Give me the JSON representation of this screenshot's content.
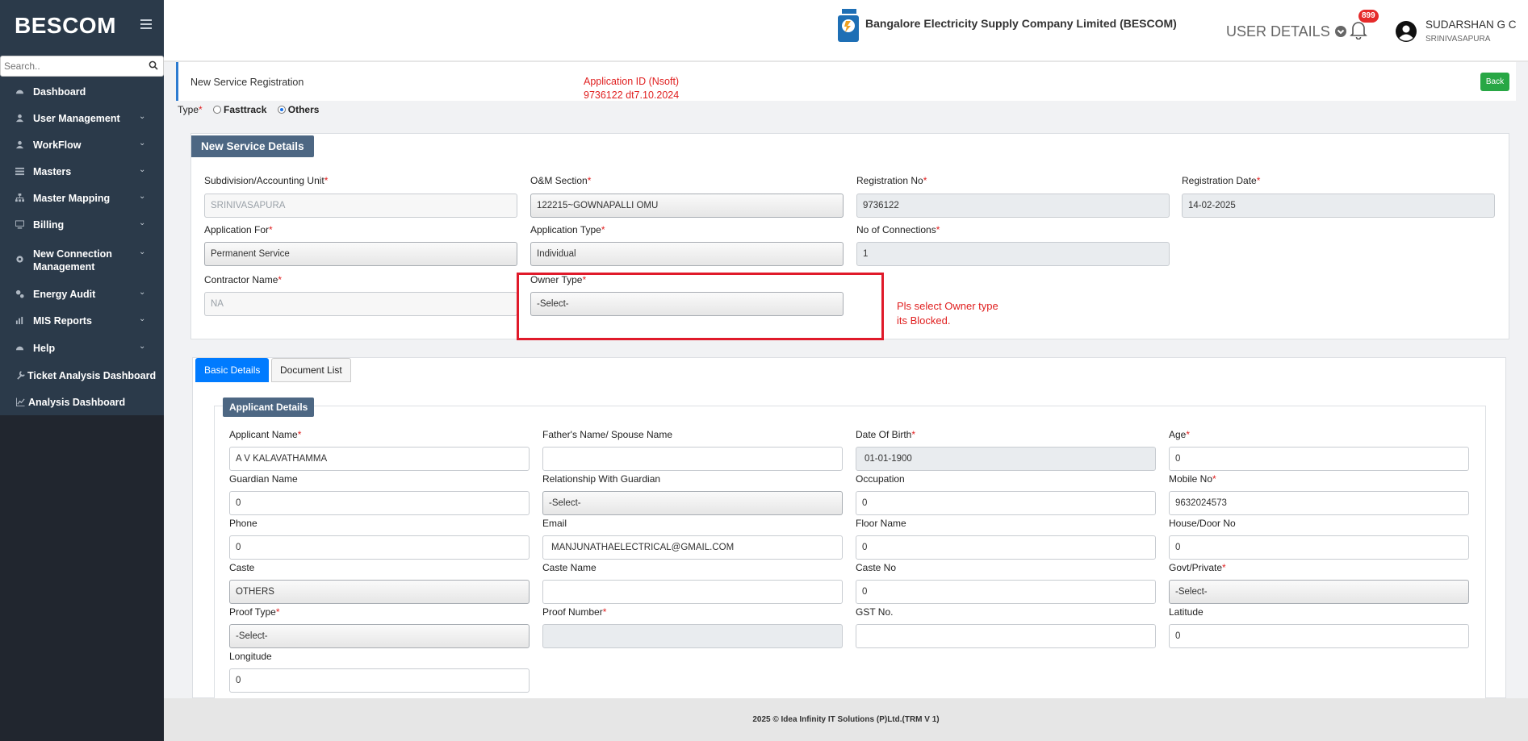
{
  "sidebar": {
    "brand": "BESCOM",
    "search_placeholder": "Search..",
    "items": [
      {
        "label": "Dashboard"
      },
      {
        "label": "User Management"
      },
      {
        "label": "WorkFlow"
      },
      {
        "label": "Masters"
      },
      {
        "label": "Master Mapping"
      },
      {
        "label": "Billing"
      },
      {
        "label": "New Connection Management"
      },
      {
        "label": "Energy Audit"
      },
      {
        "label": "MIS Reports"
      },
      {
        "label": "Help"
      },
      {
        "label": "Ticket Analysis Dashboard"
      },
      {
        "label": "Analysis Dashboard"
      }
    ]
  },
  "header": {
    "company": "Bangalore Electricity Supply Company Limited (BESCOM)",
    "user_details": "USER DETAILS",
    "notification_count": "899",
    "user_name": "SUDARSHAN G C",
    "user_location": "SRINIVASAPURA"
  },
  "page": {
    "title": "New Service Registration",
    "app_id_line1": "Application ID (Nsoft)",
    "app_id_line2": "9736122 dt7.10.2024",
    "back": "Back",
    "type_label": "Type",
    "type_fasttrack": "Fasttrack",
    "type_others": "Others",
    "annotation_line1": "Pls select Owner type",
    "annotation_line2": "its Blocked."
  },
  "service": {
    "heading": "New Service Details",
    "fields": {
      "subdivision": {
        "label": "Subdivision/Accounting Unit",
        "value": "SRINIVASAPURA"
      },
      "om_section": {
        "label": "O&M Section",
        "value": "122215~GOWNAPALLI OMU"
      },
      "registration_no": {
        "label": "Registration No",
        "value": "9736122"
      },
      "registration_date": {
        "label": "Registration Date",
        "value": "14-02-2025"
      },
      "application_for": {
        "label": "Application For",
        "value": "Permanent Service"
      },
      "application_type": {
        "label": "Application Type",
        "value": "Individual"
      },
      "no_connections": {
        "label": "No of Connections",
        "value": "1"
      },
      "contractor_name": {
        "label": "Contractor Name",
        "value": "NA"
      },
      "owner_type": {
        "label": "Owner Type",
        "value": "-Select-"
      }
    }
  },
  "tabs": {
    "basic": "Basic Details",
    "documents": "Document List"
  },
  "applicant": {
    "heading": "Applicant Details",
    "fields": {
      "applicant_name": {
        "label": "Applicant Name",
        "value": "A V KALAVATHAMMA"
      },
      "father_name": {
        "label": "Father's Name/ Spouse Name",
        "value": ""
      },
      "dob": {
        "label": "Date Of Birth",
        "value": "01-01-1900"
      },
      "age": {
        "label": "Age",
        "value": "0"
      },
      "guardian_name": {
        "label": "Guardian Name",
        "value": "0"
      },
      "relationship": {
        "label": "Relationship With Guardian",
        "value": "-Select-"
      },
      "occupation": {
        "label": "Occupation",
        "value": "0"
      },
      "mobile": {
        "label": "Mobile No",
        "value": "9632024573"
      },
      "phone": {
        "label": "Phone",
        "value": "0"
      },
      "email": {
        "label": "Email",
        "value": "MANJUNATHAELECTRICAL@GMAIL.COM"
      },
      "floor_name": {
        "label": "Floor Name",
        "value": "0"
      },
      "house_no": {
        "label": "House/Door No",
        "value": "0"
      },
      "caste": {
        "label": "Caste",
        "value": "OTHERS"
      },
      "caste_name": {
        "label": "Caste Name",
        "value": ""
      },
      "caste_no": {
        "label": "Caste No",
        "value": "0"
      },
      "govt_private": {
        "label": "Govt/Private",
        "value": "-Select-"
      },
      "proof_type": {
        "label": "Proof Type",
        "value": "-Select-"
      },
      "proof_number": {
        "label": "Proof Number",
        "value": ""
      },
      "gst_no": {
        "label": "GST No.",
        "value": ""
      },
      "latitude": {
        "label": "Latitude",
        "value": "0"
      },
      "longitude": {
        "label": "Longitude",
        "value": "0"
      }
    }
  },
  "footer": "2025 © Idea Infinity IT Solutions (P)Ltd.(TRM V 1)"
}
